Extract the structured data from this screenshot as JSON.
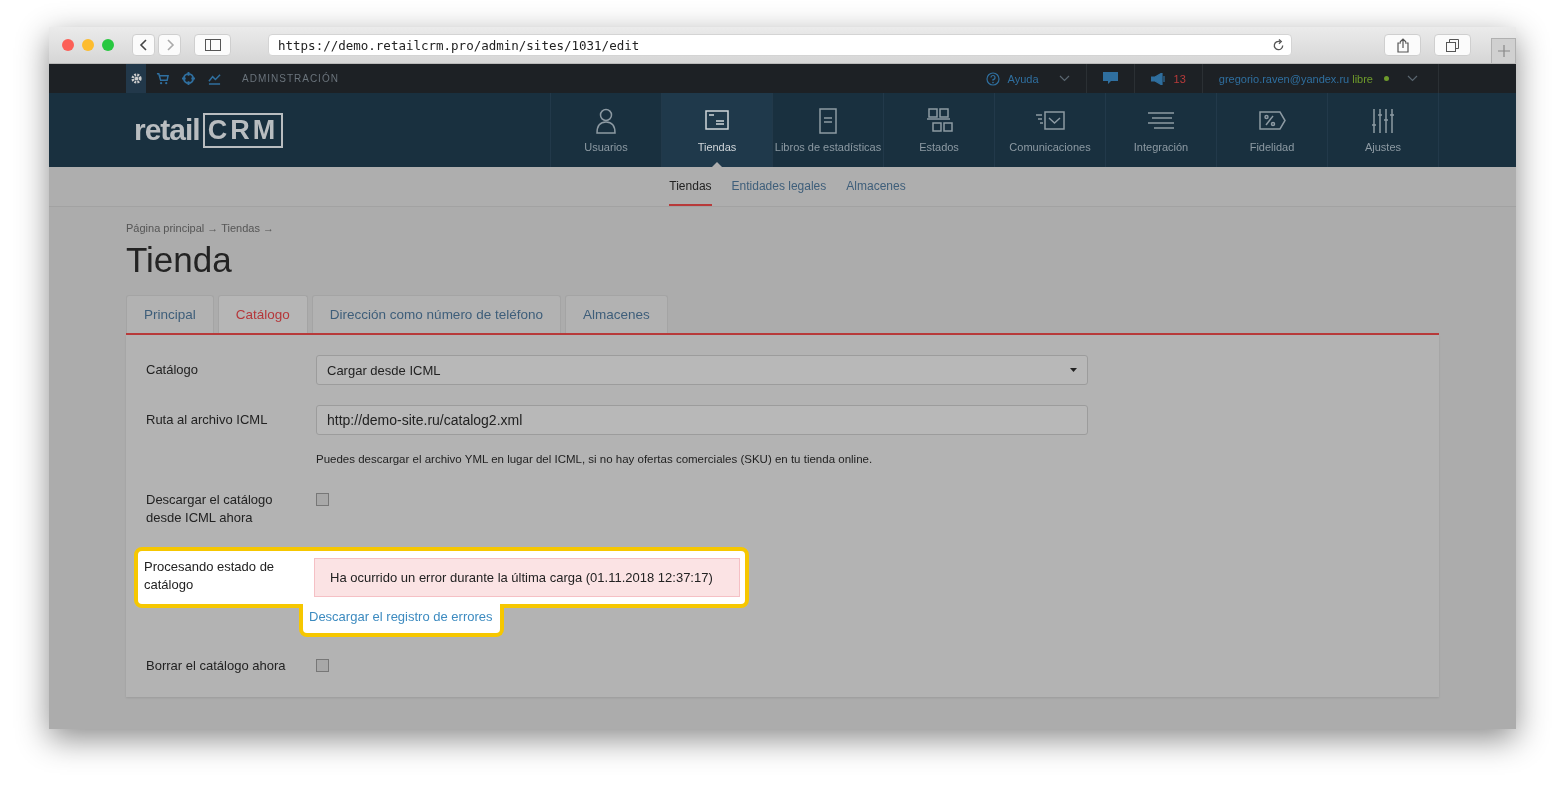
{
  "browser": {
    "url": "https://demo.retailcrm.pro/admin/sites/1031/edit"
  },
  "top_bar": {
    "tools": [
      {
        "selected": true
      },
      {
        "selected": false
      },
      {
        "selected": false
      },
      {
        "selected": false
      }
    ],
    "section": "ADMINSTRACIÓN",
    "help": "Ayuda",
    "notifications": "13",
    "user_email": "gregorio.raven@yandex.ru",
    "user_status": "libre"
  },
  "logo": {
    "text_1": "retail",
    "text_2": "CRM"
  },
  "nav": [
    {
      "label": "Usuarios",
      "selected": false
    },
    {
      "label": "Tiendas",
      "selected": true
    },
    {
      "label": "Libros de estadísticas",
      "selected": false
    },
    {
      "label": "Estados",
      "selected": false
    },
    {
      "label": "Comunicaciones",
      "selected": false
    },
    {
      "label": "Integración",
      "selected": false
    },
    {
      "label": "Fidelidad",
      "selected": false
    },
    {
      "label": "Ajustes",
      "selected": false
    }
  ],
  "subnav": [
    {
      "label": "Tiendas",
      "selected": true
    },
    {
      "label": "Entidades legales",
      "selected": false
    },
    {
      "label": "Almacenes",
      "selected": false
    }
  ],
  "breadcrumbs": "Página principal → Tiendas →",
  "title": "Tienda",
  "tabs": [
    {
      "label": "Principal",
      "selected": false
    },
    {
      "label": "Catálogo",
      "selected": true
    },
    {
      "label": "Dirección como número de teléfono",
      "selected": false
    },
    {
      "label": "Almacenes",
      "selected": false
    }
  ],
  "form": [
    {
      "kind": "select",
      "label": "Catálogo",
      "value": "Cargar desde ICML"
    },
    {
      "kind": "input",
      "label": "Ruta al archivo ICML",
      "value": "http://demo-site.ru/catalog2.xml",
      "hint": "Puedes descargar el archivo YML en lugar del ICML, si no hay ofertas comerciales (SKU) en tu tienda online."
    },
    {
      "kind": "checkbox",
      "label": "Descargar el catálogo desde ICML ahora",
      "checked": false
    },
    {
      "kind": "status",
      "label": "Procesando estado de catálogo",
      "message": "Ha ocurrido un error durante la última carga (01.11.2018 12:37:17)",
      "link": "Descargar el registro de errores",
      "highlighted": true
    },
    {
      "kind": "checkbox",
      "label": "Borrar el catálogo ahora",
      "checked": false
    }
  ]
}
